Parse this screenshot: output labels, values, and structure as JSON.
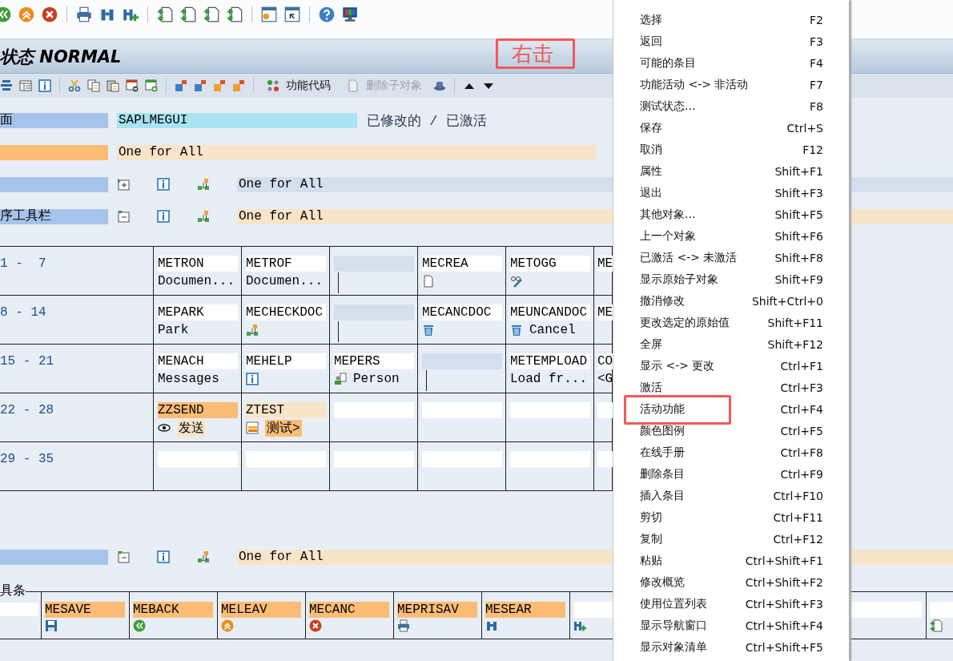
{
  "title": "状态 NORMAL",
  "annotation": "右击",
  "app_toolbar": {
    "buttons": [
      {
        "label": "功能代码",
        "disabled": false
      },
      {
        "label": "删除子对象",
        "disabled": true
      }
    ]
  },
  "header_rows": [
    {
      "label": "面",
      "color": "#a6c4ea",
      "kind": "field",
      "value": {
        "text": "SAPLMEGUI",
        "color": "#a8e4f2"
      },
      "status": "已修改的 / 已激活"
    },
    {
      "color": "#fbbd75",
      "kind": "field",
      "value": {
        "text": "One for All",
        "color": "#f8e4c9"
      }
    },
    {
      "color": "#a6c4ea",
      "kind": "tools",
      "expanded": false,
      "value": {
        "text": "One for All",
        "color": "#d3dfee"
      }
    },
    {
      "label": "序工具栏",
      "color": "#a6c4ea",
      "kind": "tools",
      "expanded": true,
      "value": {
        "text": "One for All",
        "color": "#f8e4c9"
      }
    }
  ],
  "table": {
    "rows": [
      {
        "range": "1 -  7",
        "cells": [
          {
            "kind": "entry",
            "code": "METRON",
            "color": "#ffffff",
            "text": "Documen..."
          },
          {
            "kind": "entry",
            "code": "METROF",
            "color": "#ffffff",
            "text": "Documen..."
          },
          {
            "kind": "separator",
            "color": "#d3dfee"
          },
          {
            "kind": "entry",
            "code": "MECREA",
            "color": "#ffffff"
          },
          {
            "kind": "entry",
            "code": "METOGG",
            "color": "#ffffff"
          },
          {
            "kind": "entry",
            "code": "ME",
            "color": "#ffffff"
          }
        ]
      },
      {
        "range": "8 - 14",
        "cells": [
          {
            "kind": "entry",
            "code": "MEPARK",
            "color": "#ffffff",
            "text": "Park"
          },
          {
            "kind": "entry",
            "code": "MECHECKDOC",
            "color": "#ffffff"
          },
          {
            "kind": "separator",
            "color": "#d3dfee"
          },
          {
            "kind": "entry",
            "code": "MECANCDOC",
            "color": "#ffffff"
          },
          {
            "kind": "entry",
            "code": "MEUNCANDOC",
            "color": "#ffffff",
            "text": "Cancel"
          },
          {
            "kind": "entry",
            "code": "ME",
            "color": "#ffffff"
          }
        ]
      },
      {
        "range": "15 - 21",
        "cells": [
          {
            "kind": "entry",
            "code": "MENACH",
            "color": "#ffffff",
            "text": "Messages"
          },
          {
            "kind": "entry",
            "code": "MEHELP",
            "color": "#ffffff"
          },
          {
            "kind": "entry",
            "code": "MEPERS",
            "color": "#ffffff",
            "text": "Person"
          },
          {
            "kind": "separator",
            "color": "#d3dfee"
          },
          {
            "kind": "entry",
            "code": "METEMPLOAD",
            "color": "#ffffff",
            "text": "Load fr..."
          },
          {
            "kind": "entry",
            "code": "CO",
            "color": "#ffffff",
            "text": "<G"
          }
        ]
      },
      {
        "range": "22 - 28",
        "cells": [
          {
            "kind": "entry",
            "code": "ZZSEND",
            "color": "#fbbd75",
            "label": {
              "text": "发送",
              "color": "#f8e4c9"
            }
          },
          {
            "kind": "entry",
            "code": "ZTEST",
            "color": "#f8e4c9",
            "label": {
              "text": "测试>",
              "color": "#fbbd75"
            }
          },
          {
            "kind": "empty",
            "color": "#ffffff"
          },
          {
            "kind": "empty",
            "color": "#ffffff"
          },
          {
            "kind": "empty",
            "color": "#ffffff"
          },
          {
            "kind": "empty",
            "color": "#ffffff"
          }
        ]
      },
      {
        "range": "29 - 35",
        "cells": [
          {
            "kind": "empty",
            "color": "#ffffff"
          },
          {
            "kind": "empty",
            "color": "#ffffff"
          },
          {
            "kind": "empty",
            "color": "#ffffff"
          },
          {
            "kind": "empty",
            "color": "#ffffff"
          },
          {
            "kind": "empty",
            "color": "#ffffff"
          },
          {
            "kind": "empty",
            "color": "#ffffff"
          }
        ]
      }
    ]
  },
  "toolbar_row": {
    "color": "#a6c4ea",
    "expanded": true,
    "value": {
      "text": "One for All",
      "color": "#f8e4c9"
    }
  },
  "function_keys": {
    "label": "具条",
    "keys": [
      {
        "code": "MESAVE",
        "color": "#fbbd75"
      },
      {
        "code": "MEBACK",
        "color": "#fbbd75"
      },
      {
        "code": "MELEAV",
        "color": "#fbbd75"
      },
      {
        "code": "MECANC",
        "color": "#fbbd75"
      },
      {
        "code": "MEPRISAV",
        "color": "#fbbd75"
      },
      {
        "code": "MESEAR",
        "color": "#fbbd75"
      },
      {
        "color": "#ffffff"
      },
      {
        "color": "#ffffff"
      },
      {
        "color": "#ffffff"
      }
    ]
  },
  "context_menu": {
    "items": [
      {
        "label": "选择",
        "shortcut": "F2",
        "marked": false
      },
      {
        "label": "返回",
        "shortcut": "F3",
        "marked": false
      },
      {
        "label": "可能的条目",
        "shortcut": "F4",
        "marked": false
      },
      {
        "label": "功能活动 <-> 非活动",
        "shortcut": "F7",
        "marked": false
      },
      {
        "label": "测试状态...",
        "shortcut": "F8",
        "marked": false
      },
      {
        "label": "保存",
        "shortcut": "Ctrl+S",
        "marked": false
      },
      {
        "label": "取消",
        "shortcut": "F12",
        "marked": false
      },
      {
        "label": "属性",
        "shortcut": "Shift+F1",
        "marked": false
      },
      {
        "label": "退出",
        "shortcut": "Shift+F3",
        "marked": false
      },
      {
        "label": "其他对象...",
        "shortcut": "Shift+F5",
        "marked": false
      },
      {
        "label": "上一个对象",
        "shortcut": "Shift+F6",
        "marked": false
      },
      {
        "label": "已激活 <-> 未激活",
        "shortcut": "Shift+F8",
        "marked": false
      },
      {
        "label": "显示原始子对象",
        "shortcut": "Shift+F9",
        "marked": false
      },
      {
        "label": "撤消修改",
        "shortcut": "Shift+Ctrl+0",
        "marked": false
      },
      {
        "label": "更改选定的原始值",
        "shortcut": "Shift+F11",
        "marked": false
      },
      {
        "label": "全屏",
        "shortcut": "Shift+F12",
        "marked": false
      },
      {
        "label": "显示 <-> 更改",
        "shortcut": "Ctrl+F1",
        "marked": false
      },
      {
        "label": "激活",
        "shortcut": "Ctrl+F3",
        "marked": false
      },
      {
        "label": "活动功能",
        "shortcut": "Ctrl+F4",
        "marked": true
      },
      {
        "label": "颜色图例",
        "shortcut": "Ctrl+F5",
        "marked": false
      },
      {
        "label": "在线手册",
        "shortcut": "Ctrl+F8",
        "marked": false
      },
      {
        "label": "删除条目",
        "shortcut": "Ctrl+F9",
        "marked": false
      },
      {
        "label": "插入条目",
        "shortcut": "Ctrl+F10",
        "marked": false
      },
      {
        "label": "剪切",
        "shortcut": "Ctrl+F11",
        "marked": false
      },
      {
        "label": "复制",
        "shortcut": "Ctrl+F12",
        "marked": false
      },
      {
        "label": "粘贴",
        "shortcut": "Ctrl+Shift+F1",
        "marked": false
      },
      {
        "label": "修改概览",
        "shortcut": "Ctrl+Shift+F2",
        "marked": false
      },
      {
        "label": "使用位置列表",
        "shortcut": "Ctrl+Shift+F3",
        "marked": false
      },
      {
        "label": "显示导航窗口",
        "shortcut": "Ctrl+Shift+F4",
        "marked": false
      },
      {
        "label": "显示对象清单",
        "shortcut": "Ctrl+Shift+F5",
        "marked": false
      }
    ]
  }
}
